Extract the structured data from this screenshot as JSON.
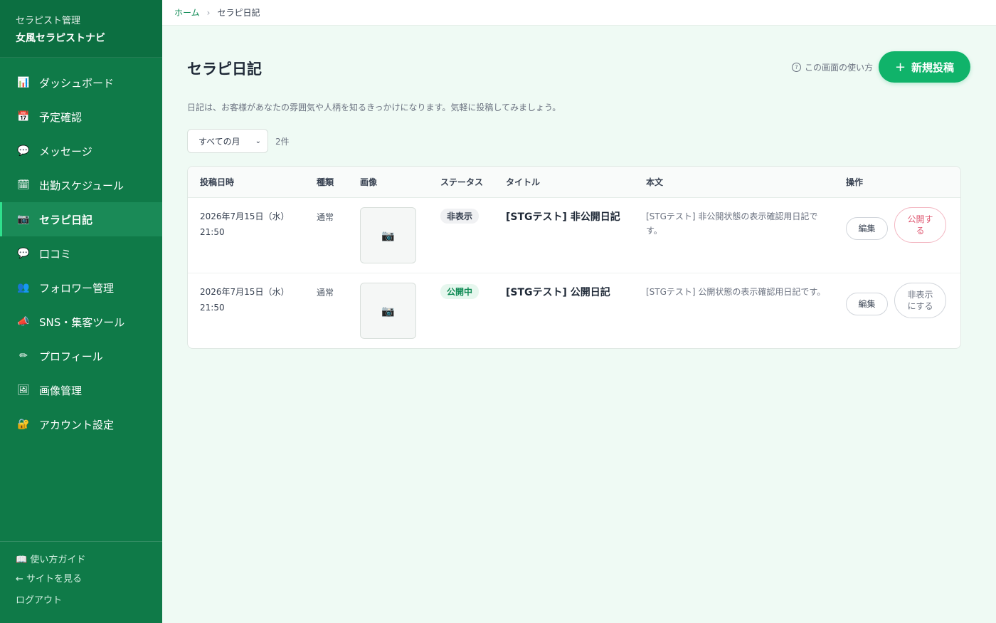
{
  "sidebar": {
    "brand_sub": "セラピスト管理",
    "brand_main": "女風セラピストナビ",
    "items": [
      {
        "label": "ダッシュボード",
        "icon": "chart-icon",
        "glyph": "📊"
      },
      {
        "label": "予定確認",
        "icon": "calendar-icon",
        "glyph": "📅"
      },
      {
        "label": "メッセージ",
        "icon": "speech-bubble-icon",
        "glyph": "💬"
      },
      {
        "label": "出勤スケジュール",
        "icon": "schedule-icon",
        "glyph": "🗓"
      },
      {
        "label": "セラピ日記",
        "icon": "camera-icon",
        "glyph": "📷",
        "active": true
      },
      {
        "label": "口コミ",
        "icon": "review-bubble-icon",
        "glyph": "💬"
      },
      {
        "label": "フォロワー管理",
        "icon": "followers-icon",
        "glyph": "👥"
      },
      {
        "label": "SNS・集客ツール",
        "icon": "megaphone-icon",
        "glyph": "📣"
      },
      {
        "label": "プロフィール",
        "icon": "pencil-icon",
        "glyph": "✏"
      },
      {
        "label": "画像管理",
        "icon": "image-icon",
        "glyph": "🖼"
      },
      {
        "label": "アカウント設定",
        "icon": "lock-icon",
        "glyph": "🔐"
      }
    ],
    "footer": {
      "guide": "📖 使い方ガイド",
      "view_site": "← サイトを見る",
      "logout": "ログアウト"
    }
  },
  "breadcrumb": {
    "home": "ホーム",
    "sep": "›",
    "current": "セラピ日記"
  },
  "page": {
    "title": "セラピ日記",
    "help_icon": "?",
    "help": "この画面の使い方",
    "new_post_icon": "+",
    "new_post": "新規投稿",
    "description": "日記は、お客様があなたの雰囲気や人柄を知るきっかけになります。気軽に投稿してみましょう。"
  },
  "filter": {
    "month": "すべての月",
    "chevron": "⌄",
    "count": "2件"
  },
  "table": {
    "headers": {
      "date": "投稿日時",
      "kind": "種類",
      "image": "画像",
      "status": "ステータス",
      "title": "タイトル",
      "body": "本文",
      "ops": "操作"
    },
    "rows": [
      {
        "date": "2026年7月15日（水）",
        "time": "21:50",
        "kind": "通常",
        "thumb": "📷",
        "status": "非表示",
        "title": "[STGテスト] 非公開日記",
        "body": "[STGテスト] 非公開状態の表示確認用日記です。",
        "edit": "編集",
        "toggle": "公開する"
      },
      {
        "date": "2026年7月15日（水）",
        "time": "21:50",
        "kind": "通常",
        "thumb": "📷",
        "status": "公開中",
        "title": "[STGテスト] 公開日記",
        "body": "[STGテスト] 公開状態の表示確認用日記です。",
        "edit": "編集",
        "toggle": "非表示にする"
      }
    ]
  },
  "colors": {
    "sidebar": "#0f7a48",
    "accent": "#10b36a",
    "page_bg": "#effaf4",
    "danger": "#e05c75"
  }
}
